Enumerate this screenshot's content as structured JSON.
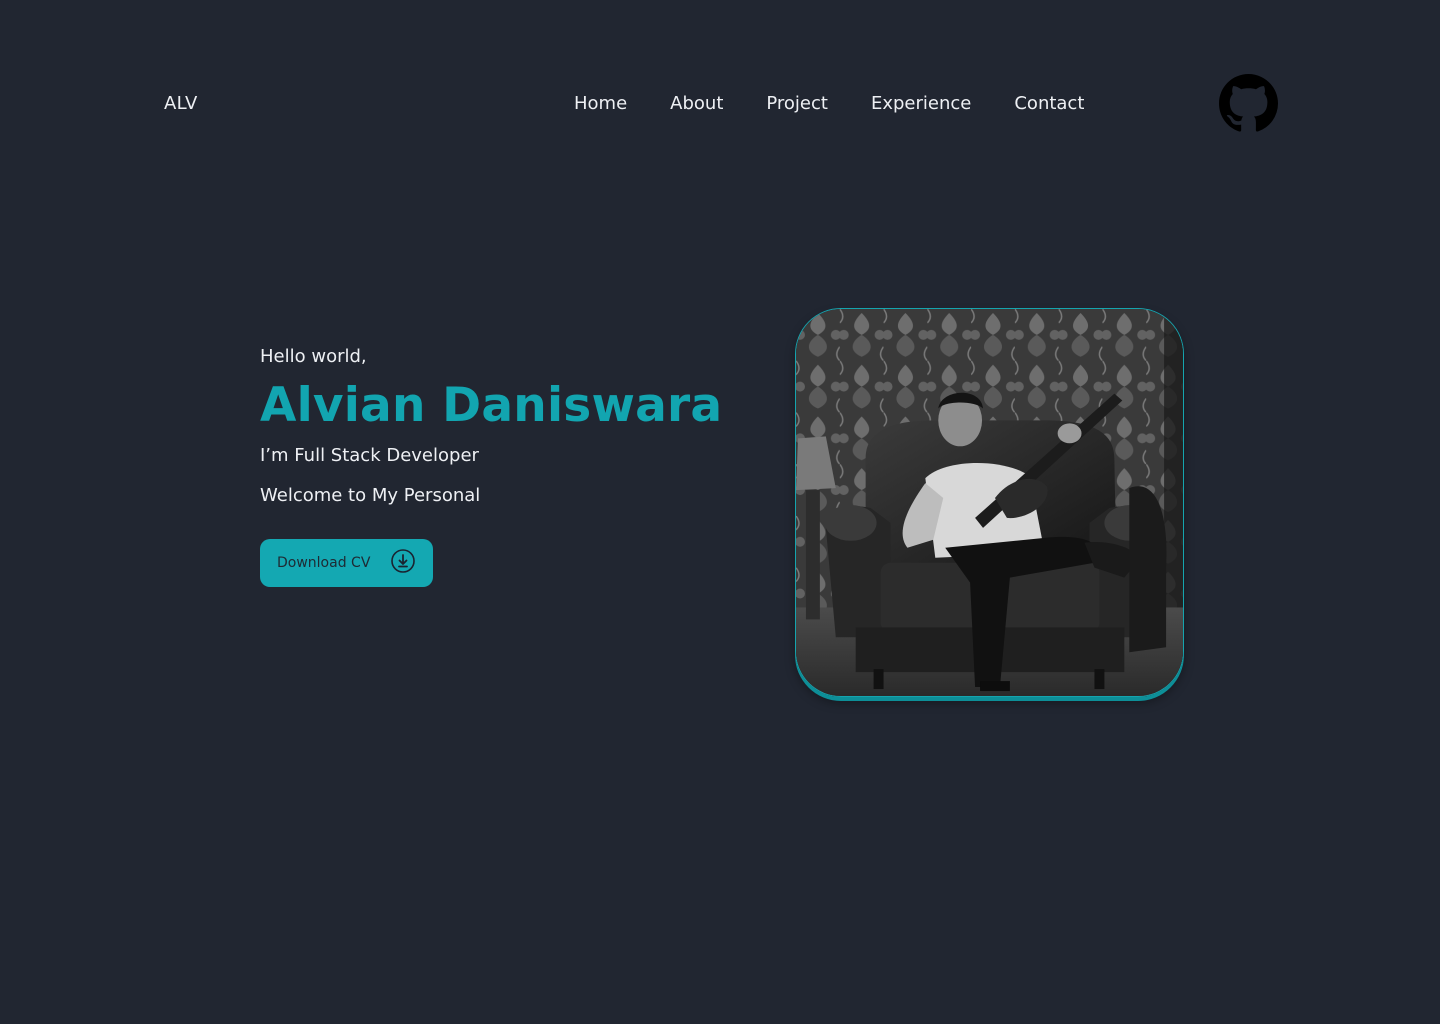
{
  "header": {
    "logo": "ALV",
    "nav": [
      "Home",
      "About",
      "Project",
      "Experience",
      "Contact"
    ],
    "github_icon": "github-icon"
  },
  "hero": {
    "greeting": "Hello world,",
    "name": "Alvian Daniswara",
    "role": "I’m Full Stack Developer",
    "welcome": "Welcome to My Personal",
    "cta_label": "Download CV",
    "cta_icon": "download-circle-icon",
    "photo": "portrait-photo"
  },
  "colors": {
    "background": "#212631",
    "accent": "#14a8b2",
    "text": "#eef0f4"
  }
}
